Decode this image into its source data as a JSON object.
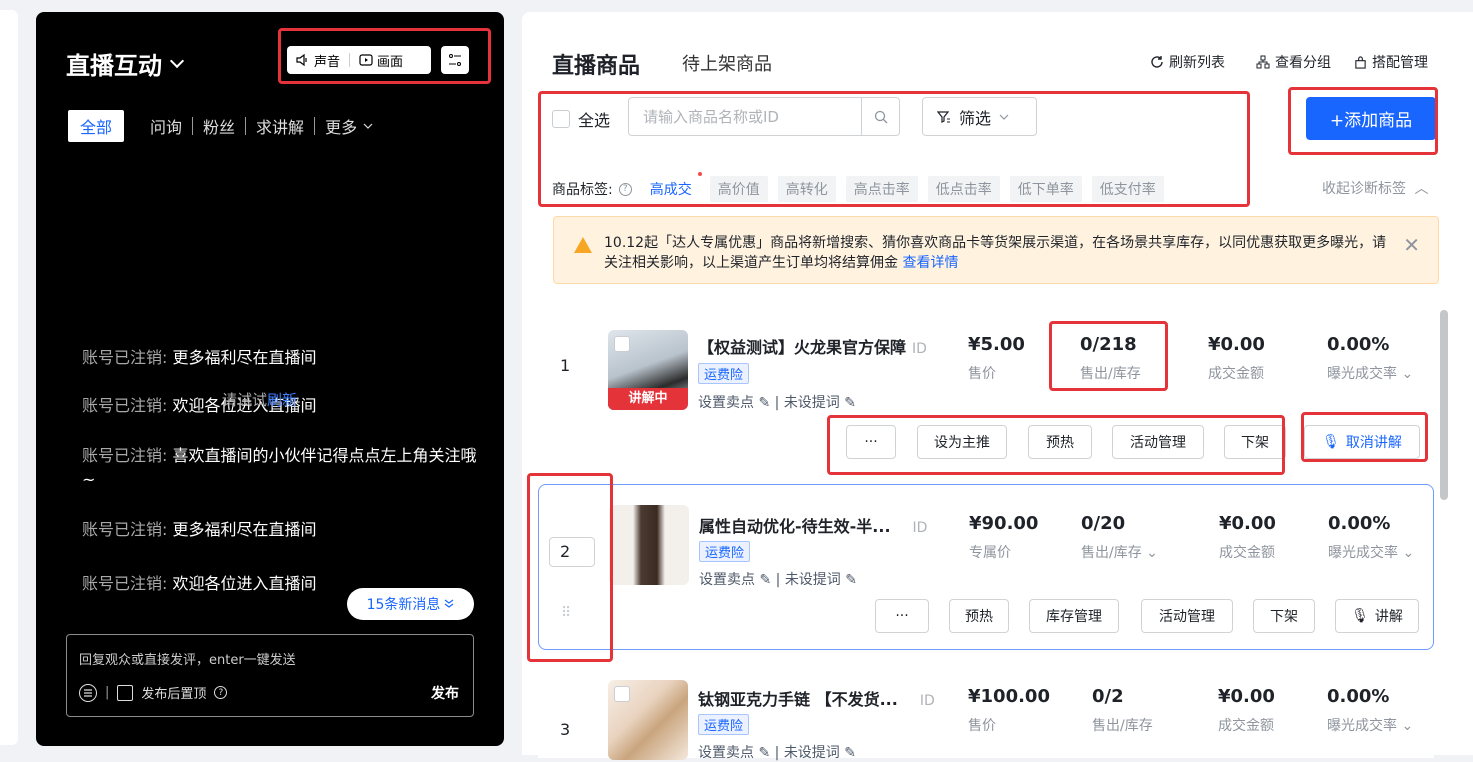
{
  "live_panel": {
    "title": "直播互动",
    "sound_label": "声音",
    "picture_label": "画面",
    "tabs": {
      "all": "全部",
      "inquiry": "问询",
      "fans": "粉丝",
      "explain": "求讲解",
      "more": "更多"
    },
    "messages": [
      {
        "who": "账号已注销:",
        "text": "更多福利尽在直播间"
      },
      {
        "who": "账号已注销:",
        "text": "欢迎各位进入直播间"
      },
      {
        "who": "账号已注销:",
        "text": "喜欢直播间的小伙伴记得点点左上角关注哦~"
      },
      {
        "who": "账号已注销:",
        "text": "更多福利尽在直播间"
      },
      {
        "who": "账号已注销:",
        "text": "欢迎各位进入直播间"
      }
    ],
    "retry_text": "请试试",
    "retry_link": "刷新",
    "new_messages": "15条新消息",
    "reply_placeholder": "回复观众或直接发评，enter一键发送",
    "pin_label": "发布后置顶",
    "send_label": "发布"
  },
  "products_panel": {
    "title": "直播商品",
    "tab_pending": "待上架商品",
    "actions": {
      "refresh": "刷新列表",
      "groups": "查看分组",
      "bundle": "搭配管理"
    },
    "select_all": "全选",
    "search_placeholder": "请输入商品名称或ID",
    "filter_label": "筛选",
    "add_button": "+添加商品",
    "tags_label": "商品标签:",
    "tags": [
      "高成交",
      "高价值",
      "高转化",
      "高点击率",
      "低点击率",
      "低下单率",
      "低支付率"
    ],
    "collapse_label": "收起诊断标签",
    "notice_text": "10.12起「达人专属优惠」商品将新增搜索、猜你喜欢商品卡等货架展示渠道，在各场景共享库存，以同优惠获取更多曝光，请关注相关影响，以上渠道产生订单均将结算佣金",
    "notice_link": "查看详情",
    "items": [
      {
        "num": "1",
        "title": "【权益测试】火龙果官方保障",
        "id_label": "ID",
        "insurance": "运费险",
        "selling_point": "设置卖点",
        "keyword": "未设提词",
        "price": "¥5.00",
        "price_label": "售价",
        "sold": "0/218",
        "sold_label": "售出/库存",
        "gmv": "¥0.00",
        "gmv_label": "成交金额",
        "rate": "0.00%",
        "rate_label": "曝光成交率",
        "badge": "讲解中",
        "buttons": [
          "···",
          "设为主推",
          "预热",
          "活动管理",
          "下架"
        ],
        "explain_button": "取消讲解"
      },
      {
        "num": "2",
        "title": "属性自动优化-待生效-半...",
        "id_label": "ID",
        "insurance": "运费险",
        "selling_point": "设置卖点",
        "keyword": "未设提词",
        "price": "¥90.00",
        "price_label": "专属价",
        "sold": "0/20",
        "sold_label": "售出/库存",
        "gmv": "¥0.00",
        "gmv_label": "成交金额",
        "rate": "0.00%",
        "rate_label": "曝光成交率",
        "buttons": [
          "···",
          "预热",
          "库存管理",
          "活动管理",
          "下架"
        ],
        "explain_button": "讲解"
      },
      {
        "num": "3",
        "title": "钛钢亚克力手链 【不发货...",
        "id_label": "ID",
        "insurance": "运费险",
        "selling_point": "设置卖点",
        "keyword": "未设提词",
        "price": "¥100.00",
        "price_label": "售价",
        "sold": "0/2",
        "sold_label": "售出/库存",
        "gmv": "¥0.00",
        "gmv_label": "成交金额",
        "rate": "0.00%",
        "rate_label": "曝光成交率"
      }
    ]
  },
  "colors": {
    "accent": "#1966ff",
    "highlight": "#e5333a"
  }
}
